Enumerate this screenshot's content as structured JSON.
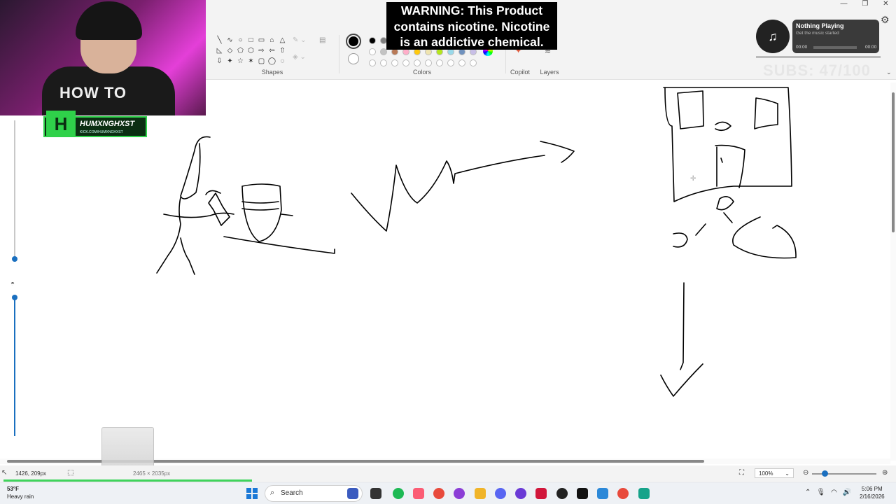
{
  "ribbon": {
    "shapes_label": "Shapes",
    "colors_label": "Colors",
    "copilot_label": "Copilot",
    "layers_label": "Layers",
    "shape_glyphs": [
      "╲",
      "∿",
      "○",
      "□",
      "▭",
      "⌂",
      "△",
      "◺",
      "◇",
      "⬠",
      "⬡",
      "⇨",
      "⇦",
      "⇧",
      "⇩",
      "✦",
      "☆",
      "✶",
      "▢",
      "◯",
      "◌"
    ],
    "palette_row1": [
      "#000000",
      "#7f7f7f"
    ],
    "palette_row2": [
      "#ffffff",
      "#c3c3c3",
      "#b97a57",
      "#ffaec9",
      "#ffc90e",
      "#efe4b0",
      "#b5e61d",
      "#99d9ea",
      "#7092be",
      "#c8bfe7"
    ],
    "palette_row3": [
      "#ffffff",
      "#ffffff",
      "#ffffff",
      "#ffffff",
      "#ffffff",
      "#ffffff",
      "#ffffff",
      "#ffffff",
      "#ffffff",
      "#ffffff"
    ]
  },
  "warning": {
    "line1": "WARNING: This Product",
    "line2": "contains nicotine. Nicotine",
    "line3": "is an addictive chemical."
  },
  "music": {
    "title": "Nothing Playing",
    "subtitle": "Get the music started",
    "time_start": "00:00",
    "time_end": "00:00"
  },
  "subs": "SUBS: 47/100",
  "webcam": {
    "shirt_text": "HOW TO",
    "badge_logo": "H",
    "badge_name": "HUMXNGHXST",
    "badge_url": "KICK.COM/HUMXNGHXST"
  },
  "statusbar": {
    "cursor_pos": "1426, 209px",
    "canvas_size": "2465 × 2035px",
    "zoom": "100%"
  },
  "taskbar": {
    "temperature": "53°F",
    "weather": "Heavy rain",
    "search_placeholder": "Search",
    "time": "5:06 PM",
    "date": "2/16/2026"
  },
  "colors": {
    "accent": "#1a6fbf",
    "badge_green": "#2fd14a"
  }
}
